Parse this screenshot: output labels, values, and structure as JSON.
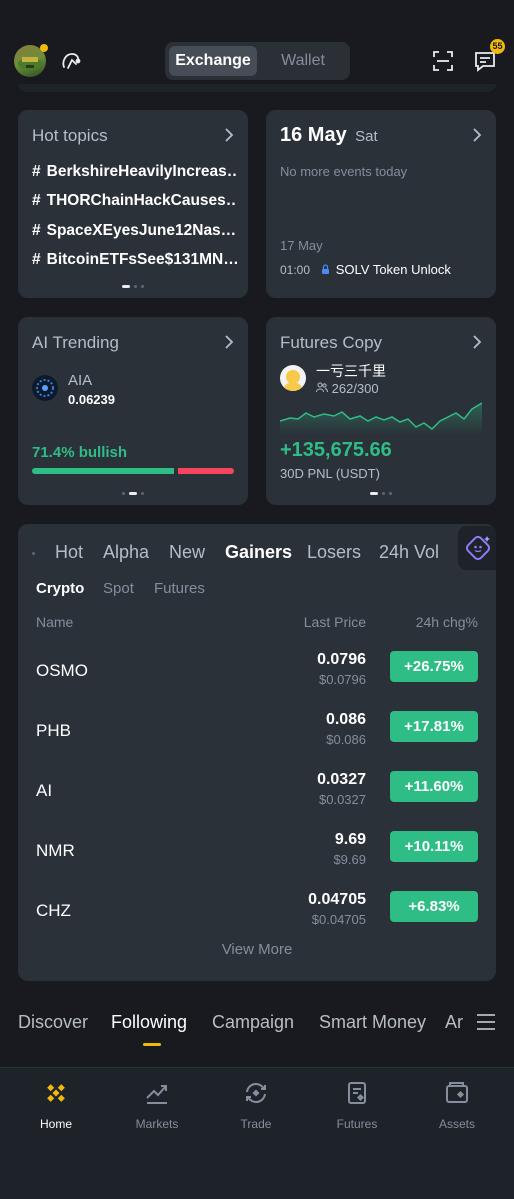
{
  "header": {
    "seg_exchange": "Exchange",
    "seg_wallet": "Wallet",
    "message_badge": "55"
  },
  "hot_topics": {
    "title": "Hot topics",
    "items": [
      "BerkshireHeavilyIncreas…",
      "THORChainHackCauses…",
      "SpaceXEyesJune12Nas…",
      "BitcoinETFsSee$131MN…"
    ]
  },
  "calendar": {
    "date": "16 May",
    "weekday": "Sat",
    "empty_note": "No more events today",
    "next_date": "17 May",
    "next_time": "01:00",
    "next_event": "SOLV Token Unlock"
  },
  "ai_trending": {
    "title": "AI Trending",
    "symbol": "AIA",
    "price": "0.06239",
    "sentiment": "71.4% bullish",
    "bullish_fraction": 0.714
  },
  "futures_copy": {
    "title": "Futures Copy",
    "trader": "一亏三千里",
    "followers": "262/300",
    "pnl": "+135,675.66",
    "pnl_label": "30D PNL (USDT)"
  },
  "market": {
    "tabs": [
      "Hot",
      "Alpha",
      "New",
      "Gainers",
      "Losers",
      "24h Vol"
    ],
    "subtabs": [
      "Crypto",
      "Spot",
      "Futures"
    ],
    "col_name": "Name",
    "col_price": "Last Price",
    "col_change": "24h chg%",
    "rows": [
      {
        "name": "OSMO",
        "price": "0.0796",
        "fiat": "$0.0796",
        "change": "+26.75%"
      },
      {
        "name": "PHB",
        "price": "0.086",
        "fiat": "$0.086",
        "change": "+17.81%"
      },
      {
        "name": "AI",
        "price": "0.0327",
        "fiat": "$0.0327",
        "change": "+11.60%"
      },
      {
        "name": "NMR",
        "price": "9.69",
        "fiat": "$9.69",
        "change": "+10.11%"
      },
      {
        "name": "CHZ",
        "price": "0.04705",
        "fiat": "$0.04705",
        "change": "+6.83%"
      }
    ],
    "view_more": "View More"
  },
  "feed_tabs": [
    "Discover",
    "Following",
    "Campaign",
    "Smart Money",
    "Ar"
  ],
  "bottom_nav": [
    {
      "label": "Home",
      "icon": "binance-logo-icon"
    },
    {
      "label": "Markets",
      "icon": "chart-icon"
    },
    {
      "label": "Trade",
      "icon": "trade-icon"
    },
    {
      "label": "Futures",
      "icon": "futures-icon"
    },
    {
      "label": "Assets",
      "icon": "wallet-icon"
    }
  ],
  "colors": {
    "accent": "#f0b90b",
    "up": "#2ebd85",
    "down": "#f6465d"
  }
}
